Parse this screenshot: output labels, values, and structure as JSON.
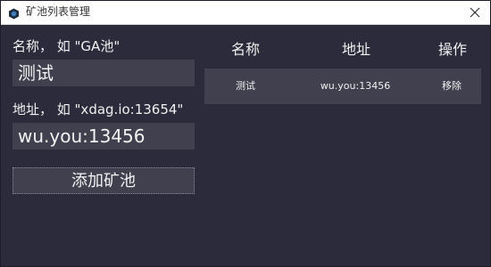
{
  "window": {
    "title": "矿池列表管理",
    "icon": "app-hexagon-icon",
    "close_icon": "close-icon"
  },
  "form": {
    "name_label": "名称， 如 \"GA池\"",
    "name_value": "测试",
    "address_label": "地址， 如 \"xdag.io:13654\"",
    "address_value": "wu.you:13456",
    "add_button_label": "添加矿池"
  },
  "table": {
    "columns": [
      "名称",
      "地址",
      "操作"
    ],
    "rows": [
      {
        "name": "测试",
        "address": "wu.you:13456",
        "action": "移除"
      }
    ]
  },
  "colors": {
    "background": "#2b2b3b",
    "field_background": "#40404f",
    "text": "#f0f0f0",
    "titlebar": "#ffffff"
  }
}
